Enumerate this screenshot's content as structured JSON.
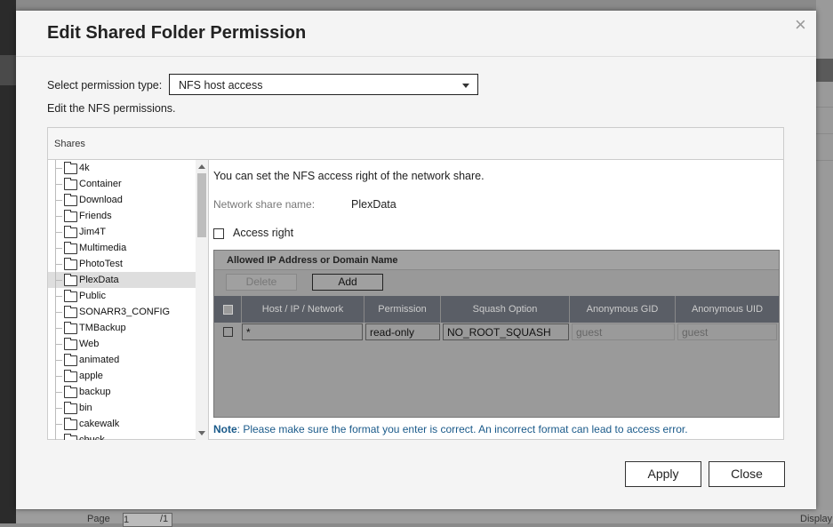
{
  "background": {
    "footer": {
      "page_label": "Page",
      "page_value": "1",
      "page_total": "/1",
      "display_label": "Display"
    }
  },
  "dialog": {
    "title": "Edit Shared Folder Permission",
    "close_glyph": "×",
    "permission_type_label": "Select permission type:",
    "permission_type_value": "NFS host access",
    "description": "Edit the NFS permissions.",
    "shares_header": "Shares",
    "folders": [
      {
        "label": "4k"
      },
      {
        "label": "Container"
      },
      {
        "label": "Download"
      },
      {
        "label": "Friends"
      },
      {
        "label": "Jim4T"
      },
      {
        "label": "Multimedia"
      },
      {
        "label": "PhotoTest"
      },
      {
        "label": "PlexData",
        "selected": true
      },
      {
        "label": "Public"
      },
      {
        "label": "SONARR3_CONFIG"
      },
      {
        "label": "TMBackup"
      },
      {
        "label": "Web"
      },
      {
        "label": "animated"
      },
      {
        "label": "apple"
      },
      {
        "label": "backup"
      },
      {
        "label": "bin"
      },
      {
        "label": "cakewalk"
      },
      {
        "label": "chuck"
      }
    ],
    "content": {
      "intro": "You can set the NFS access right of the network share.",
      "share_name_label": "Network share name:",
      "share_name_value": "PlexData",
      "access_right_label": "Access right",
      "grid": {
        "title": "Allowed IP Address or Domain Name",
        "delete_label": "Delete",
        "add_label": "Add",
        "columns": [
          "Host / IP / Network",
          "Permission",
          "Squash Option",
          "Anonymous GID",
          "Anonymous UID"
        ],
        "rows": [
          {
            "host": "*",
            "permission": "read-only",
            "squash": "NO_ROOT_SQUASH",
            "gid": "guest",
            "uid": "guest"
          }
        ]
      },
      "note_label": "Note",
      "note_text": ": Please make sure the format you enter is correct. An incorrect format can lead to access error."
    },
    "apply_label": "Apply",
    "close_label": "Close"
  },
  "colors": {
    "accent_note": "#1a5a8a",
    "grid_header": "#5a5e66",
    "selected_row": "#dedede"
  }
}
